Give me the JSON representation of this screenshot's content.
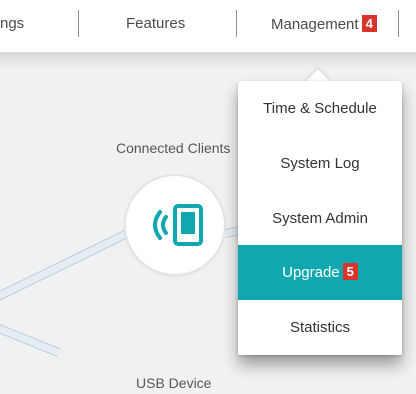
{
  "nav": {
    "items": [
      {
        "label": "ngs"
      },
      {
        "label": "Features"
      },
      {
        "label": "Management",
        "badge": "4"
      }
    ]
  },
  "map": {
    "connected_clients_label": "Connected Clients",
    "usb_device_label": "USB Device"
  },
  "dropdown": {
    "items": [
      {
        "label": "Time & Schedule"
      },
      {
        "label": "System Log"
      },
      {
        "label": "System Admin"
      },
      {
        "label": "Upgrade",
        "badge": "5",
        "selected": true
      },
      {
        "label": "Statistics"
      }
    ]
  },
  "colors": {
    "accent_teal": "#11a7b1",
    "badge_red": "#d9342b",
    "background_gray": "#f1f1f1"
  },
  "icons": {
    "client_node": "wireless-tablet-icon"
  }
}
